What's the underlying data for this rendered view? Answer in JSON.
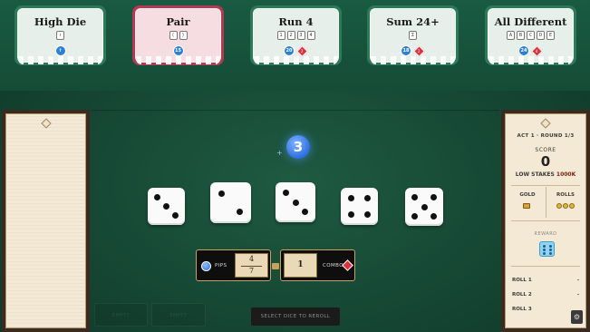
{
  "hands": [
    {
      "title": "High Die",
      "chips": [
        "↑"
      ],
      "badges": [
        {
          "kind": "circle",
          "text": "↑"
        }
      ]
    },
    {
      "title": "Pair",
      "chips": [
        "(",
        ")"
      ],
      "badges": [
        {
          "kind": "circle",
          "text": "15"
        }
      ]
    },
    {
      "title": "Run 4",
      "chips": [
        "1",
        "2",
        "3",
        "4"
      ],
      "badges": [
        {
          "kind": "circle",
          "text": "20"
        },
        {
          "kind": "diamond",
          "text": "2"
        }
      ]
    },
    {
      "title": "Sum 24+",
      "chips": [
        "Σ"
      ],
      "badges": [
        {
          "kind": "circle",
          "text": "18"
        },
        {
          "kind": "diamond",
          "text": "2"
        }
      ]
    },
    {
      "title": "All Different",
      "chips": [
        "A",
        "B",
        "C",
        "D",
        "E"
      ],
      "badges": [
        {
          "kind": "circle",
          "text": "24"
        },
        {
          "kind": "diamond",
          "text": "4"
        }
      ]
    }
  ],
  "round_indicator": {
    "plus": "+",
    "value": "3"
  },
  "dice": [
    {
      "face": 3,
      "highlight": false
    },
    {
      "face": 2,
      "highlight": false
    },
    {
      "face": 3,
      "highlight": false
    },
    {
      "face": 4,
      "highlight": false
    },
    {
      "face": 5,
      "highlight": false
    }
  ],
  "scoring": {
    "pips_label": "PIPS",
    "pips_top": "4",
    "pips_bottom": "7",
    "combo_label": "COMBO",
    "combo_value": "1"
  },
  "sidebar": {
    "round_text": "ACT 1 · ROUND 1/3",
    "score_label": "SCORE",
    "score_value": "0",
    "stakes_label": "LOW STAKES",
    "stakes_goal": "1000K",
    "gold_label": "GOLD",
    "rolls_label": "ROLLS",
    "rolls_remaining": 3,
    "reward_label": "REWARD",
    "rolls": [
      {
        "label": "ROLL 1",
        "value": "-"
      },
      {
        "label": "ROLL 2",
        "value": "-"
      },
      {
        "label": "ROLL 3",
        "value": ""
      }
    ]
  },
  "bottom": {
    "empty1": "EMPTY",
    "empty2": "EMPTY",
    "reroll": "SELECT DICE TO REROLL"
  },
  "colors": {
    "felt": "#174a36",
    "accent_blue": "#2e6fe0",
    "accent_red": "#d7343b",
    "gold_trim": "#c6a25d"
  }
}
